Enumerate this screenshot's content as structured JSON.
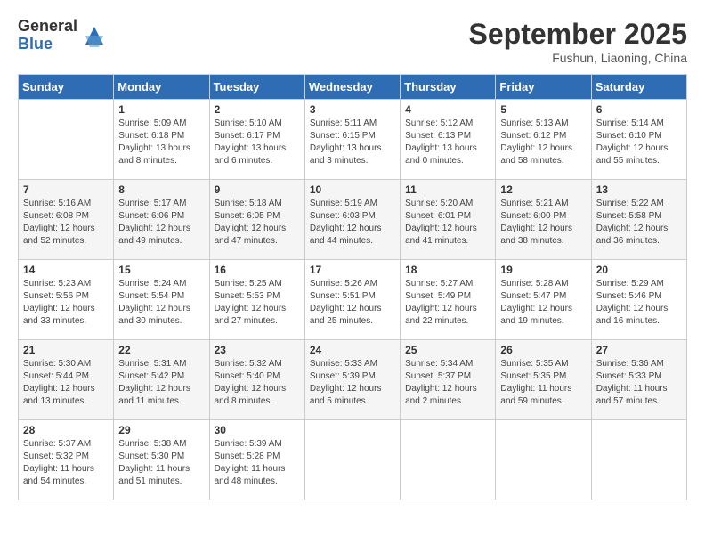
{
  "header": {
    "logo_general": "General",
    "logo_blue": "Blue",
    "month_title": "September 2025",
    "location": "Fushun, Liaoning, China"
  },
  "days_of_week": [
    "Sunday",
    "Monday",
    "Tuesday",
    "Wednesday",
    "Thursday",
    "Friday",
    "Saturday"
  ],
  "weeks": [
    [
      {
        "num": "",
        "info": ""
      },
      {
        "num": "1",
        "info": "Sunrise: 5:09 AM\nSunset: 6:18 PM\nDaylight: 13 hours\nand 8 minutes."
      },
      {
        "num": "2",
        "info": "Sunrise: 5:10 AM\nSunset: 6:17 PM\nDaylight: 13 hours\nand 6 minutes."
      },
      {
        "num": "3",
        "info": "Sunrise: 5:11 AM\nSunset: 6:15 PM\nDaylight: 13 hours\nand 3 minutes."
      },
      {
        "num": "4",
        "info": "Sunrise: 5:12 AM\nSunset: 6:13 PM\nDaylight: 13 hours\nand 0 minutes."
      },
      {
        "num": "5",
        "info": "Sunrise: 5:13 AM\nSunset: 6:12 PM\nDaylight: 12 hours\nand 58 minutes."
      },
      {
        "num": "6",
        "info": "Sunrise: 5:14 AM\nSunset: 6:10 PM\nDaylight: 12 hours\nand 55 minutes."
      }
    ],
    [
      {
        "num": "7",
        "info": "Sunrise: 5:16 AM\nSunset: 6:08 PM\nDaylight: 12 hours\nand 52 minutes."
      },
      {
        "num": "8",
        "info": "Sunrise: 5:17 AM\nSunset: 6:06 PM\nDaylight: 12 hours\nand 49 minutes."
      },
      {
        "num": "9",
        "info": "Sunrise: 5:18 AM\nSunset: 6:05 PM\nDaylight: 12 hours\nand 47 minutes."
      },
      {
        "num": "10",
        "info": "Sunrise: 5:19 AM\nSunset: 6:03 PM\nDaylight: 12 hours\nand 44 minutes."
      },
      {
        "num": "11",
        "info": "Sunrise: 5:20 AM\nSunset: 6:01 PM\nDaylight: 12 hours\nand 41 minutes."
      },
      {
        "num": "12",
        "info": "Sunrise: 5:21 AM\nSunset: 6:00 PM\nDaylight: 12 hours\nand 38 minutes."
      },
      {
        "num": "13",
        "info": "Sunrise: 5:22 AM\nSunset: 5:58 PM\nDaylight: 12 hours\nand 36 minutes."
      }
    ],
    [
      {
        "num": "14",
        "info": "Sunrise: 5:23 AM\nSunset: 5:56 PM\nDaylight: 12 hours\nand 33 minutes."
      },
      {
        "num": "15",
        "info": "Sunrise: 5:24 AM\nSunset: 5:54 PM\nDaylight: 12 hours\nand 30 minutes."
      },
      {
        "num": "16",
        "info": "Sunrise: 5:25 AM\nSunset: 5:53 PM\nDaylight: 12 hours\nand 27 minutes."
      },
      {
        "num": "17",
        "info": "Sunrise: 5:26 AM\nSunset: 5:51 PM\nDaylight: 12 hours\nand 25 minutes."
      },
      {
        "num": "18",
        "info": "Sunrise: 5:27 AM\nSunset: 5:49 PM\nDaylight: 12 hours\nand 22 minutes."
      },
      {
        "num": "19",
        "info": "Sunrise: 5:28 AM\nSunset: 5:47 PM\nDaylight: 12 hours\nand 19 minutes."
      },
      {
        "num": "20",
        "info": "Sunrise: 5:29 AM\nSunset: 5:46 PM\nDaylight: 12 hours\nand 16 minutes."
      }
    ],
    [
      {
        "num": "21",
        "info": "Sunrise: 5:30 AM\nSunset: 5:44 PM\nDaylight: 12 hours\nand 13 minutes."
      },
      {
        "num": "22",
        "info": "Sunrise: 5:31 AM\nSunset: 5:42 PM\nDaylight: 12 hours\nand 11 minutes."
      },
      {
        "num": "23",
        "info": "Sunrise: 5:32 AM\nSunset: 5:40 PM\nDaylight: 12 hours\nand 8 minutes."
      },
      {
        "num": "24",
        "info": "Sunrise: 5:33 AM\nSunset: 5:39 PM\nDaylight: 12 hours\nand 5 minutes."
      },
      {
        "num": "25",
        "info": "Sunrise: 5:34 AM\nSunset: 5:37 PM\nDaylight: 12 hours\nand 2 minutes."
      },
      {
        "num": "26",
        "info": "Sunrise: 5:35 AM\nSunset: 5:35 PM\nDaylight: 11 hours\nand 59 minutes."
      },
      {
        "num": "27",
        "info": "Sunrise: 5:36 AM\nSunset: 5:33 PM\nDaylight: 11 hours\nand 57 minutes."
      }
    ],
    [
      {
        "num": "28",
        "info": "Sunrise: 5:37 AM\nSunset: 5:32 PM\nDaylight: 11 hours\nand 54 minutes."
      },
      {
        "num": "29",
        "info": "Sunrise: 5:38 AM\nSunset: 5:30 PM\nDaylight: 11 hours\nand 51 minutes."
      },
      {
        "num": "30",
        "info": "Sunrise: 5:39 AM\nSunset: 5:28 PM\nDaylight: 11 hours\nand 48 minutes."
      },
      {
        "num": "",
        "info": ""
      },
      {
        "num": "",
        "info": ""
      },
      {
        "num": "",
        "info": ""
      },
      {
        "num": "",
        "info": ""
      }
    ]
  ]
}
